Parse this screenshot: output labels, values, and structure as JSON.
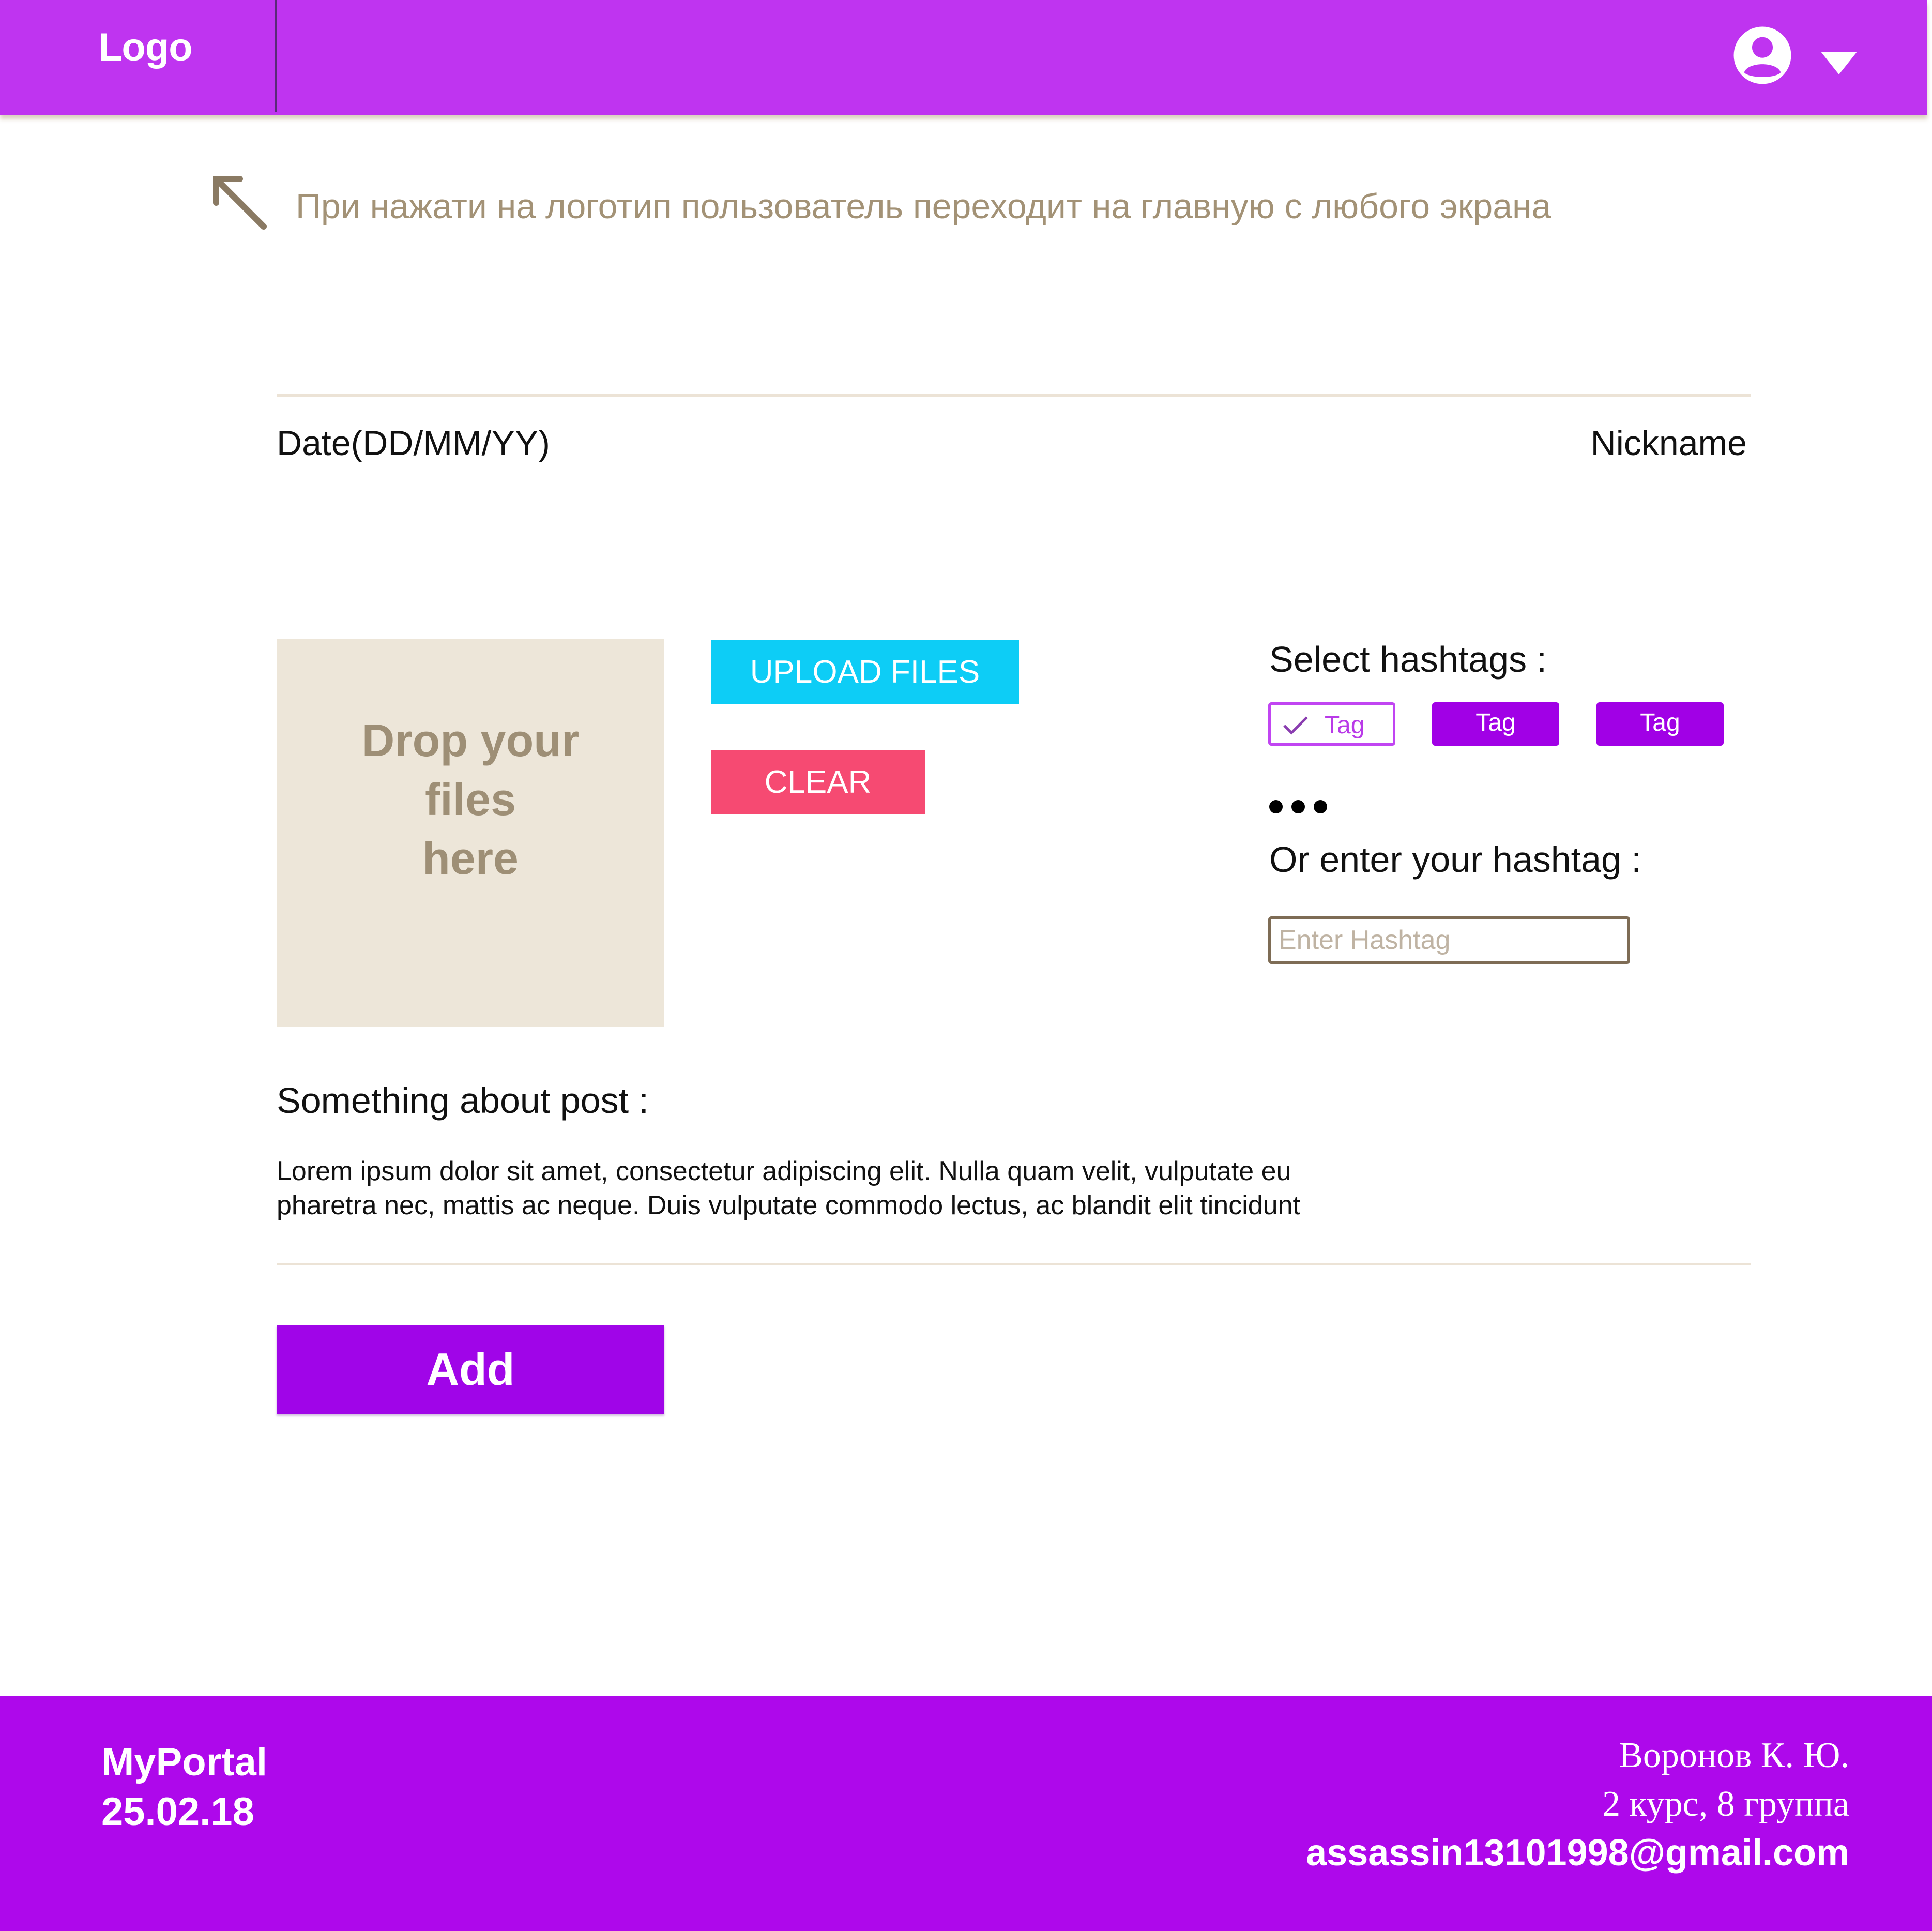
{
  "colors": {
    "header_bg": "#bf34f0",
    "footer_bg": "#ae08eb",
    "accent_purple": "#a100e6",
    "upload_button": "#0dcdf6",
    "clear_button": "#f64a72",
    "dropzone_bg": "#ede6d9",
    "note_text": "#a39276"
  },
  "header": {
    "logo": "Logo",
    "user_icon": "account-circle-icon",
    "dropdown_icon": "caret-down-icon"
  },
  "note": {
    "icon": "arrow-up-left-icon",
    "text": "При нажати на логотип пользователь переходит на главную с любого экрана"
  },
  "post": {
    "date_label": "Date(DD/MM/YY)",
    "nickname_label": "Nickname",
    "dropzone": {
      "line1": "Drop your",
      "line2": "files",
      "line3": "here"
    },
    "upload_label": "UPLOAD FILES",
    "clear_label": "CLEAR",
    "hashtags": {
      "select_label": "Select hashtags :",
      "tags": [
        {
          "label": "Tag",
          "selected": true
        },
        {
          "label": "Tag",
          "selected": false
        },
        {
          "label": "Tag",
          "selected": false
        }
      ],
      "more_icon": "more-horizontal-icon",
      "or_label": "Or enter your hashtag :",
      "input_placeholder": "Enter Hashtag",
      "input_value": ""
    },
    "about_label": "Something about post :",
    "about_text_line1": "Lorem ipsum dolor sit amet, consectetur adipiscing elit. Nulla quam velit, vulputate eu",
    "about_text_line2": "pharetra nec, mattis ac neque. Duis vulputate commodo lectus, ac blandit elit tincidunt",
    "add_label": "Add"
  },
  "footer": {
    "brand": "MyPortal",
    "date": "25.02.18",
    "author": "Воронов К. Ю.",
    "course": "2 курс, 8 группа",
    "email": "assassin13101998@gmail.com"
  }
}
